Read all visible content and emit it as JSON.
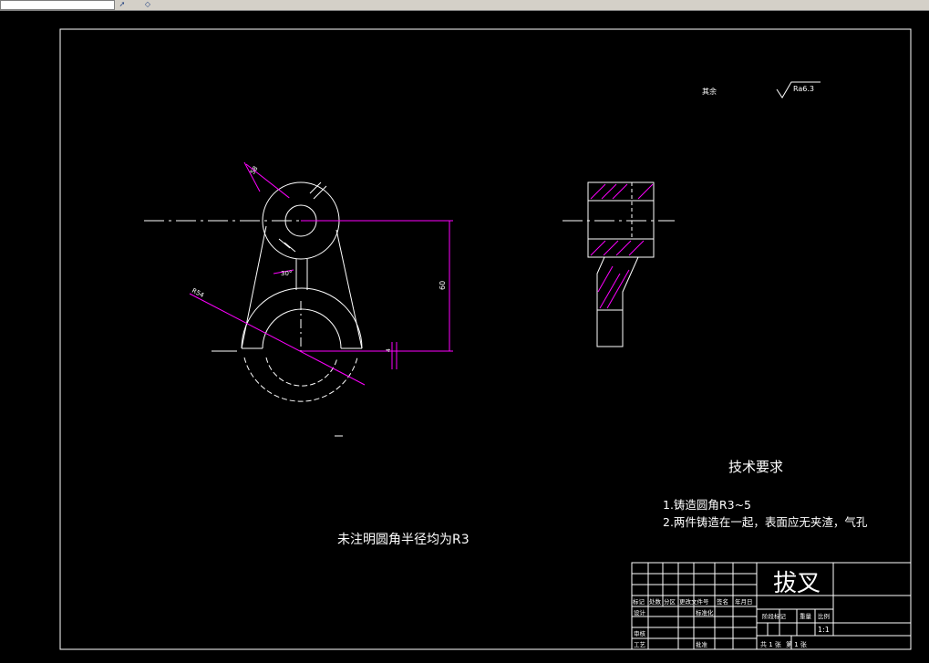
{
  "toolbar": {
    "icons": [
      "pointer-icon",
      "layers-icon"
    ]
  },
  "drawing": {
    "roughness_other": "其余",
    "roughness_symbol": "Ra6.3",
    "dims": {
      "d1": "58",
      "d2": "30°",
      "d3": "R54",
      "d4": "60",
      "d5": "4"
    },
    "tech_title": "技术要求",
    "tech_items": [
      "1.铸造圆角R3~5",
      "2.两件铸造在一起，表面应无夹渣，气孔"
    ],
    "fillet_note": "未注明圆角半径均为R3"
  },
  "title_block": {
    "part_name": "拔叉",
    "rev_headers": [
      "标记",
      "处数",
      "分区",
      "更改文件号",
      "签名",
      "年月日"
    ],
    "row_design": "设计",
    "row_standard": "标准化",
    "row_review": "审核",
    "row_process": "工艺",
    "row_approve": "批准",
    "stage_mark": "阶段标记",
    "weight": "重量",
    "scale_label": "比例",
    "scale_value": "1:1",
    "sheets_total": "共 1 张",
    "sheet_no": "第 1 张"
  },
  "colors": {
    "background": "#000000",
    "lines": "#ffffff",
    "dimensions": "#ff00ff"
  }
}
